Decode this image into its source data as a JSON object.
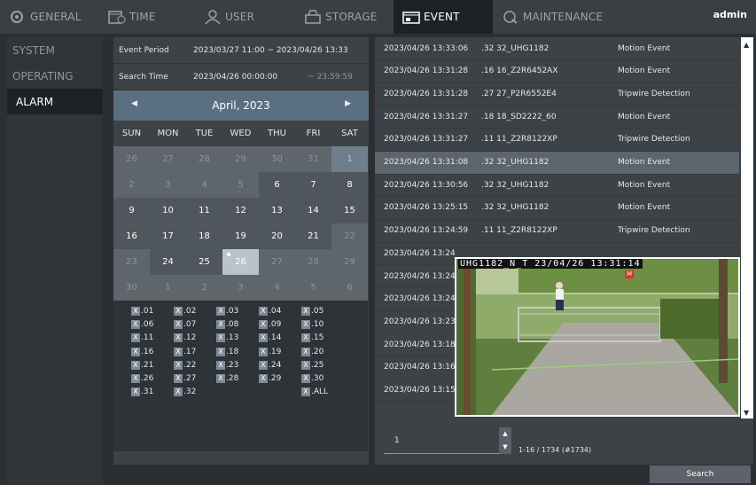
{
  "tabs": [
    {
      "label": "GENERAL",
      "icon": "gear-icon"
    },
    {
      "label": "TIME",
      "icon": "calendar-clock-icon"
    },
    {
      "label": "USER",
      "icon": "user-icon"
    },
    {
      "label": "STORAGE",
      "icon": "storage-icon"
    },
    {
      "label": "EVENT",
      "icon": "event-icon",
      "active": true
    },
    {
      "label": "MAINTENANCE",
      "icon": "wrench-icon"
    }
  ],
  "user": "admin",
  "left_menu": [
    "SYSTEM",
    "OPERATING",
    "ALARM"
  ],
  "event_period": {
    "label": "Event Period",
    "value": "2023/03/27 11:00 ~ 2023/04/26 13:33"
  },
  "search_time": {
    "label": "Search Time",
    "start": "2023/04/26 00:00:00",
    "end": "~ 23:59:59"
  },
  "calendar": {
    "month_label": "April, 2023",
    "weekdays": [
      "SUN",
      "MON",
      "TUE",
      "WED",
      "THU",
      "FRI",
      "SAT"
    ],
    "weeks": [
      [
        "26",
        "27",
        "28",
        "29",
        "30",
        "31",
        "1"
      ],
      [
        "2",
        "3",
        "4",
        "5",
        "6",
        "7",
        "8"
      ],
      [
        "9",
        "10",
        "11",
        "12",
        "13",
        "14",
        "15"
      ],
      [
        "16",
        "17",
        "18",
        "19",
        "20",
        "21",
        "22"
      ],
      [
        "23",
        "24",
        "25",
        "26",
        "27",
        "28",
        "29"
      ],
      [
        "30",
        "1",
        "2",
        "3",
        "4",
        "5",
        "6"
      ]
    ],
    "selected": "26"
  },
  "channels": [
    ".01",
    ".02",
    ".03",
    ".04",
    ".05",
    ".06",
    ".07",
    ".08",
    ".09",
    ".10",
    ".11",
    ".12",
    ".13",
    ".14",
    ".15",
    ".16",
    ".17",
    ".18",
    ".19",
    ".20",
    ".21",
    ".22",
    ".23",
    ".24",
    ".25",
    ".26",
    ".27",
    ".28",
    ".29",
    ".30",
    ".31",
    ".32",
    "",
    "",
    ".ALL"
  ],
  "events": [
    {
      "time": "2023/04/26 13:33:06",
      "camera": ".32 32_UHG1182",
      "type": "Motion Event"
    },
    {
      "time": "2023/04/26 13:31:28",
      "camera": ".16 16_Z2R6452AX",
      "type": "Motion Event"
    },
    {
      "time": "2023/04/26 13:31:28",
      "camera": ".27 27_P2R6552E4",
      "type": "Tripwire Detection"
    },
    {
      "time": "2023/04/26 13:31:27",
      "camera": ".18 18_SD2222_60",
      "type": "Motion Event"
    },
    {
      "time": "2023/04/26 13:31:27",
      "camera": ".11 11_Z2R8122XP",
      "type": "Tripwire Detection"
    },
    {
      "time": "2023/04/26 13:31:08",
      "camera": ".32 32_UHG1182",
      "type": "Motion Event"
    },
    {
      "time": "2023/04/26 13:30:56",
      "camera": ".32 32_UHG1182",
      "type": "Motion Event"
    },
    {
      "time": "2023/04/26 13:25:15",
      "camera": ".32 32_UHG1182",
      "type": "Motion Event"
    },
    {
      "time": "2023/04/26 13:24:59",
      "camera": ".11 11_Z2R8122XP",
      "type": "Tripwire Detection"
    },
    {
      "time": "2023/04/26 13:24",
      "camera": "",
      "type": ""
    },
    {
      "time": "2023/04/26 13:24",
      "camera": "",
      "type": ""
    },
    {
      "time": "2023/04/26 13:24",
      "camera": "",
      "type": ""
    },
    {
      "time": "2023/04/26 13:23",
      "camera": "",
      "type": ""
    },
    {
      "time": "2023/04/26 13:18",
      "camera": "",
      "type": ""
    },
    {
      "time": "2023/04/26 13:16",
      "camera": "",
      "type": ""
    },
    {
      "time": "2023/04/26 13:15",
      "camera": "",
      "type": ""
    }
  ],
  "selected_event_index": 5,
  "video_overlay": {
    "osd_text": "UHG1182_N_T   23/04/26   13:31:14",
    "marker": "M"
  },
  "pager": {
    "page": "1",
    "count": "1-16 / 1734 (#1734)"
  },
  "search_button": "Search"
}
